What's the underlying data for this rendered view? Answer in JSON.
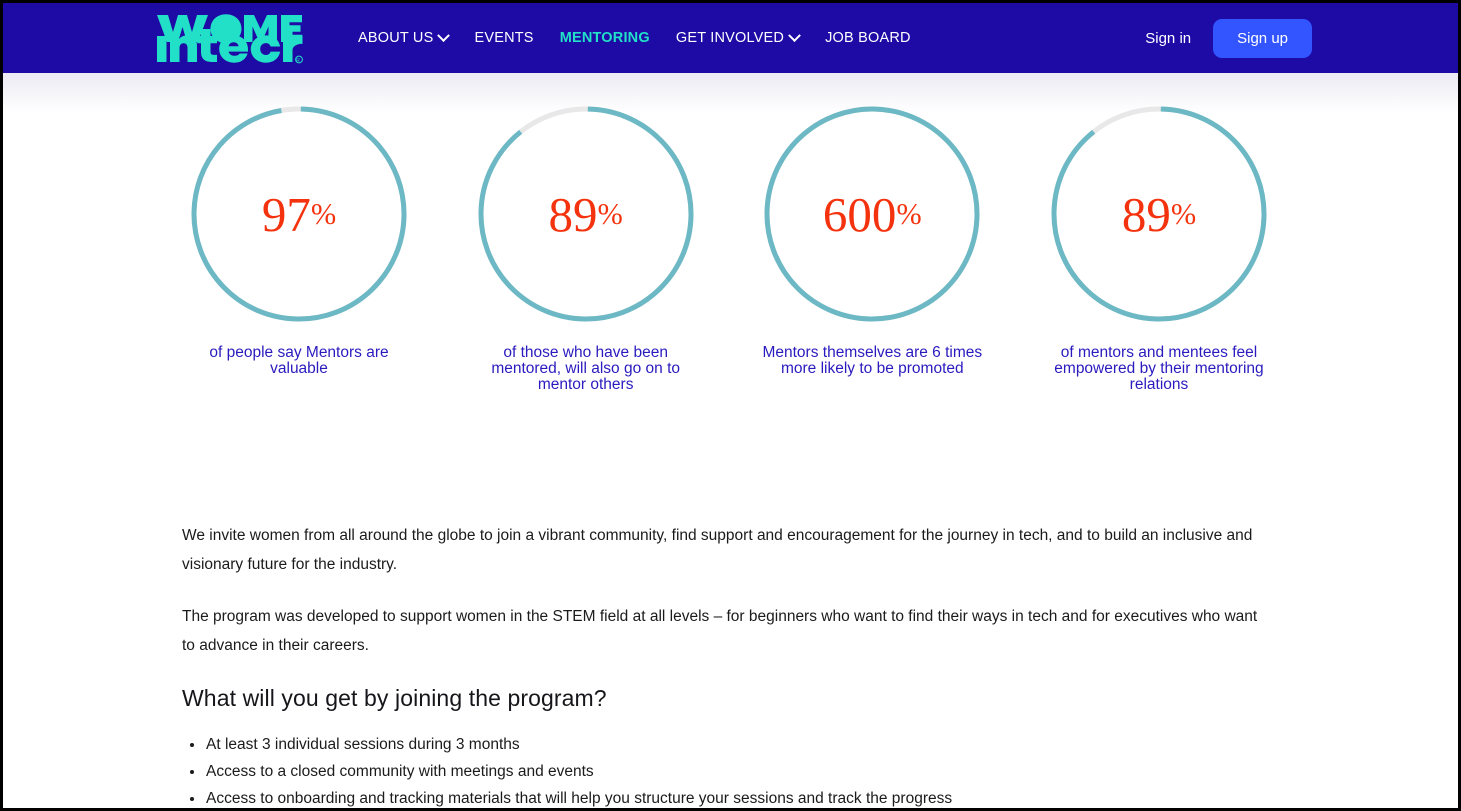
{
  "header": {
    "logo": {
      "name": "women-in-tech-logo",
      "line1": "WOMEN",
      "line2": "in tech",
      "trademark": "®"
    },
    "nav_items": [
      {
        "label": "ABOUT US",
        "has_dropdown": true,
        "active": false
      },
      {
        "label": "EVENTS",
        "has_dropdown": false,
        "active": false
      },
      {
        "label": "MENTORING",
        "has_dropdown": false,
        "active": true
      },
      {
        "label": "GET INVOLVED",
        "has_dropdown": true,
        "active": false
      },
      {
        "label": "JOB BOARD",
        "has_dropdown": false,
        "active": false
      }
    ],
    "sign_in_label": "Sign in",
    "sign_up_label": "Sign up",
    "colors": {
      "navbar_background": "#1E0BA6",
      "active_link": "#22E0C8",
      "sign_up_button": "#3355FF",
      "logo": "#22E0C8"
    }
  },
  "stats": {
    "ring_color": "#6CB8C4",
    "ring_track_color": "#E8E8E8",
    "value_color": "#F4330E",
    "caption_color": "#2A1BBE",
    "items": [
      {
        "number": "97",
        "percent_symbol": "%",
        "ring_fill_fraction": 0.97,
        "caption": "of people say Mentors are valuable"
      },
      {
        "number": "89",
        "percent_symbol": "%",
        "ring_fill_fraction": 0.89,
        "caption": "of those who have been mentored, will also go on to mentor others"
      },
      {
        "number": "600",
        "percent_symbol": "%",
        "ring_fill_fraction": 1.0,
        "caption": "Mentors themselves are 6 times more likely to be promoted"
      },
      {
        "number": "89",
        "percent_symbol": "%",
        "ring_fill_fraction": 0.89,
        "caption": "of mentors and mentees feel empowered by their mentoring relations"
      }
    ]
  },
  "main": {
    "paragraph_1": "We invite women from all around the globe to join a vibrant community, find support and encouragement for the journey in tech, and to build an inclusive and visionary future for the industry.",
    "paragraph_2": "The program was developed to support women in the STEM field at all levels – for beginners who want to find their ways in tech and for executives who want to advance in their careers.",
    "heading": "What will you get by joining the program?",
    "benefits": [
      "At least 3 individual sessions during 3 months",
      "Access to a closed community with meetings and events",
      "Access to onboarding and tracking materials that will help you structure your sessions and track the progress"
    ]
  }
}
